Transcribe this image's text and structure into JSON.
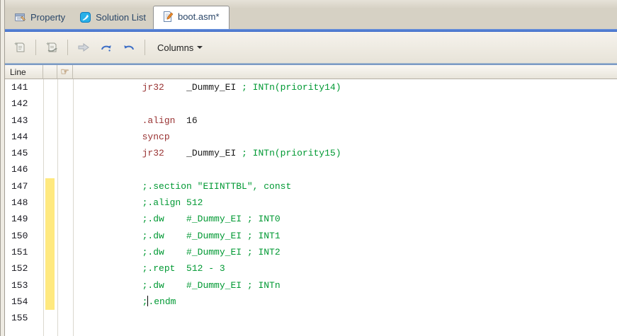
{
  "tabs": [
    {
      "label": "Property",
      "icon": "property-icon",
      "active": false
    },
    {
      "label": "Solution List",
      "icon": "solution-list-icon",
      "active": false
    },
    {
      "label": "boot.asm*",
      "icon": "document-edit-icon",
      "active": true
    }
  ],
  "toolbar": {
    "columns_label": "Columns",
    "icons": [
      "doc-star-icon",
      "doc-star-arrow-icon",
      "forward-arrow-icon",
      "redo-arrow-icon",
      "undo-arrow-icon",
      "columns-dropdown-caret-icon"
    ]
  },
  "editor": {
    "header": {
      "line_label": "Line",
      "hand_icon": "pointing-hand-icon",
      "hand_glyph": "☞"
    },
    "lines": [
      {
        "n": "141",
        "mark": false,
        "seg": [
          {
            "t": "            "
          },
          {
            "t": "jr32",
            "c": "mnemonic"
          },
          {
            "t": "    "
          },
          {
            "t": "_Dummy_EI "
          },
          {
            "t": "; INTn(priority14)",
            "c": "comment"
          }
        ]
      },
      {
        "n": "142",
        "mark": false,
        "seg": []
      },
      {
        "n": "143",
        "mark": false,
        "seg": [
          {
            "t": "            "
          },
          {
            "t": ".align",
            "c": "mnemonic"
          },
          {
            "t": "  "
          },
          {
            "t": "16",
            "c": "number"
          }
        ]
      },
      {
        "n": "144",
        "mark": false,
        "seg": [
          {
            "t": "            "
          },
          {
            "t": "syncp",
            "c": "mnemonic"
          }
        ]
      },
      {
        "n": "145",
        "mark": false,
        "seg": [
          {
            "t": "            "
          },
          {
            "t": "jr32",
            "c": "mnemonic"
          },
          {
            "t": "    "
          },
          {
            "t": "_Dummy_EI "
          },
          {
            "t": "; INTn(priority15)",
            "c": "comment"
          }
        ]
      },
      {
        "n": "146",
        "mark": false,
        "seg": []
      },
      {
        "n": "147",
        "mark": true,
        "seg": [
          {
            "t": "            "
          },
          {
            "t": ";.section \"EIINTTBL\", const",
            "c": "comment"
          }
        ]
      },
      {
        "n": "148",
        "mark": true,
        "seg": [
          {
            "t": "            "
          },
          {
            "t": ";.align 512",
            "c": "comment"
          }
        ]
      },
      {
        "n": "149",
        "mark": true,
        "seg": [
          {
            "t": "            "
          },
          {
            "t": ";.dw    #_Dummy_EI ; INT0",
            "c": "comment"
          }
        ]
      },
      {
        "n": "150",
        "mark": true,
        "seg": [
          {
            "t": "            "
          },
          {
            "t": ";.dw    #_Dummy_EI ; INT1",
            "c": "comment"
          }
        ]
      },
      {
        "n": "151",
        "mark": true,
        "seg": [
          {
            "t": "            "
          },
          {
            "t": ";.dw    #_Dummy_EI ; INT2",
            "c": "comment"
          }
        ]
      },
      {
        "n": "152",
        "mark": true,
        "seg": [
          {
            "t": "            "
          },
          {
            "t": ";.rept  512 - 3",
            "c": "comment"
          }
        ]
      },
      {
        "n": "153",
        "mark": true,
        "seg": [
          {
            "t": "            "
          },
          {
            "t": ";.dw    #_Dummy_EI ; INTn",
            "c": "comment"
          }
        ]
      },
      {
        "n": "154",
        "mark": true,
        "seg": [
          {
            "t": "            "
          },
          {
            "t": ";",
            "c": "comment"
          },
          {
            "caret": true
          },
          {
            "t": ".endm",
            "c": "comment"
          }
        ]
      },
      {
        "n": "155",
        "mark": false,
        "seg": []
      }
    ]
  },
  "colors": {
    "accent_blue": "#3a68c8",
    "tab_text": "#2a4668",
    "mnemonic": "#993333",
    "comment": "#009933",
    "number": "#1b1b1b",
    "code_text": "#1b1b1b",
    "edit_marker_yellow": "#ffe97f"
  }
}
